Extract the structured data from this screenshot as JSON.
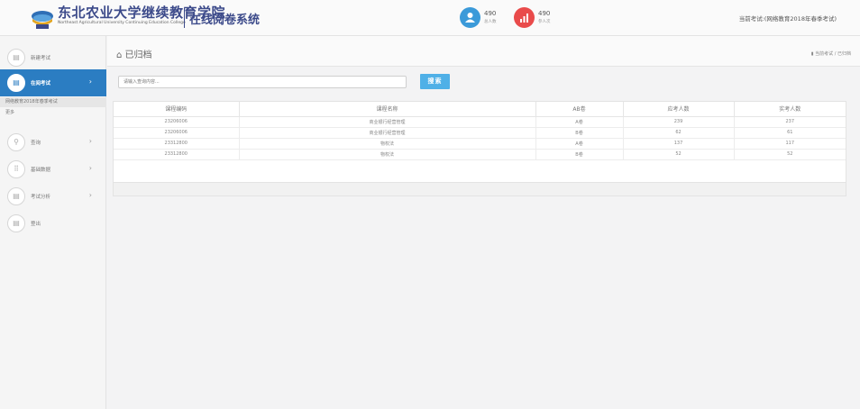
{
  "header": {
    "brand_cn": "东北农业大学继续教育学院",
    "brand_en": "Northeast Agricultural University Continuing Education College",
    "system_name": "在线阅卷系统",
    "stats": [
      {
        "value": "490",
        "label": "总人数",
        "icon": "user-icon",
        "color": "#3b9ad9"
      },
      {
        "value": "490",
        "label": "参人次",
        "icon": "bar-chart-icon",
        "color": "#e94b4b"
      }
    ],
    "current_exam": "当前考试:(网络教育2018年春季考试)"
  },
  "sidebar": {
    "items": [
      {
        "label": "新建考试",
        "icon": "list-icon",
        "arrow": ""
      },
      {
        "label": "在阅考试",
        "icon": "list-icon",
        "arrow": "›"
      },
      {
        "label": "查询",
        "icon": "search-icon",
        "arrow": "›"
      },
      {
        "label": "基础数据",
        "icon": "grid-icon",
        "arrow": "›"
      },
      {
        "label": "考试分析",
        "icon": "list-icon",
        "arrow": "›"
      },
      {
        "label": "登出",
        "icon": "list-icon",
        "arrow": ""
      }
    ],
    "sub_items": [
      "网络教育2018年春季考试",
      "更多"
    ]
  },
  "page": {
    "title": "已归档",
    "title_icon": "home-icon",
    "breadcrumb": "当前考试 / 已归档",
    "breadcrumb_icon": "doc-icon"
  },
  "search": {
    "placeholder": "请输入查询内容...",
    "button_label": "搜索"
  },
  "table": {
    "columns": [
      "课程编码",
      "课程名称",
      "AB卷",
      "应考人数",
      "实考人数"
    ],
    "rows": [
      [
        "23206006",
        "商业银行经营管理",
        "A卷",
        "239",
        "237"
      ],
      [
        "23206006",
        "商业银行经营管理",
        "B卷",
        "62",
        "61"
      ],
      [
        "23312800",
        "物权法",
        "A卷",
        "137",
        "117"
      ],
      [
        "23312800",
        "物权法",
        "B卷",
        "52",
        "52"
      ]
    ]
  },
  "colors": {
    "brand": "#3c4a8a",
    "active_nav": "#2b7dc2",
    "search_button": "#4fb0e7"
  }
}
